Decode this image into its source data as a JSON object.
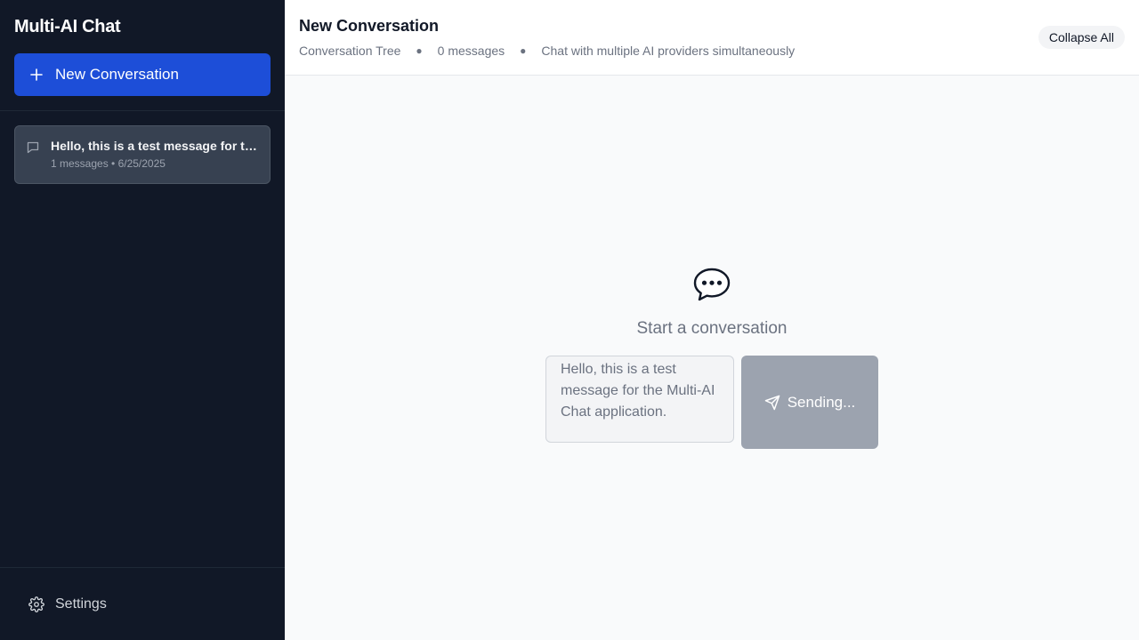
{
  "sidebar": {
    "app_title": "Multi-AI Chat",
    "new_conversation_label": "New Conversation",
    "conversations": [
      {
        "title": "Hello, this is a test message for the Multi-AI Chat application.",
        "meta": "1 messages • 6/25/2025",
        "icon": "chat-icon"
      }
    ],
    "settings_label": "Settings"
  },
  "header": {
    "title": "New Conversation",
    "view_label": "Conversation Tree",
    "message_count": "0 messages",
    "description": "Chat with multiple AI providers simultaneously",
    "collapse_label": "Collapse All"
  },
  "main": {
    "empty_icon": "speech-bubble-icon",
    "empty_text": "Start a conversation",
    "input_value": "Hello, this is a test message for the Multi-AI Chat application.",
    "send_label": "Sending...",
    "send_icon": "send-icon"
  },
  "colors": {
    "sidebar_bg": "#111827",
    "accent": "#1d4ed8",
    "disabled_button": "#9ca3af",
    "main_bg": "#f9fafb"
  }
}
